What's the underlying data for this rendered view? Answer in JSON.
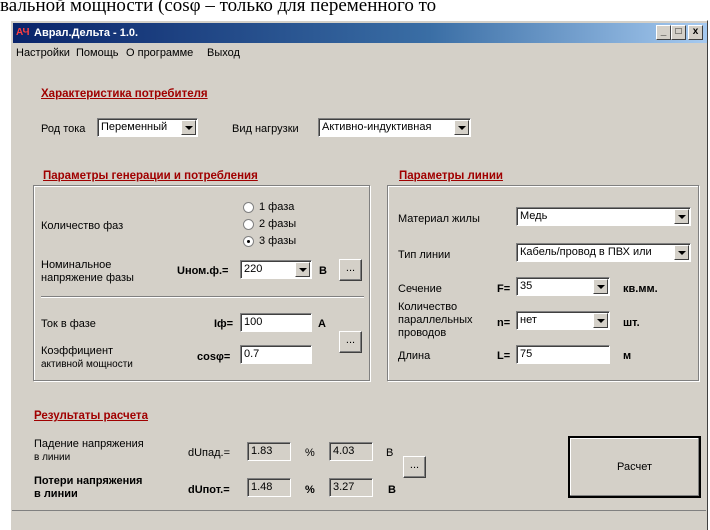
{
  "top_clip_text": "вальной мощности (cosφ – только для переменного то",
  "window": {
    "title": "Аврал.Дельта - 1.0.",
    "icon": "АЧ",
    "controls": [
      "_",
      "□",
      "x"
    ]
  },
  "menu": [
    "Настройки",
    "Помощь",
    "О программе",
    "Выход"
  ],
  "consumer": {
    "title": "Характеристика потребителя",
    "current_type_label": "Род тока",
    "current_type_value": "Переменный",
    "load_type_label": "Вид нагрузки",
    "load_type_value": "Активно-индуктивная"
  },
  "generation": {
    "title": "Параметры генерации и потребления",
    "phases_label": "Количество фаз",
    "phase_options": [
      "1 фаза",
      "2 фазы",
      "3 фазы"
    ],
    "phase_selected": 2,
    "voltage_label_1": "Номинальное",
    "voltage_label_2": "напряжение фазы",
    "voltage_symbol": "Uном.ф.=",
    "voltage_value": "220",
    "voltage_unit": "В",
    "current_label": "Ток в фазе",
    "current_symbol": "Iф=",
    "current_value": "100",
    "current_unit": "А",
    "cos_label_1": "Коэффициент",
    "cos_label_2": "активной мощности",
    "cos_symbol": "cosφ=",
    "cos_value": "0.7",
    "ellipsis": "..."
  },
  "line": {
    "title": "Параметры линии",
    "material_label": "Материал жилы",
    "material_value": "Медь",
    "linetype_label": "Тип линии",
    "linetype_value": "Кабель/провод в ПВХ или",
    "section_label": "Сечение",
    "section_symbol": "F=",
    "section_value": "35",
    "section_unit": "кв.мм.",
    "parallel_label_1": "Количество",
    "parallel_label_2": "параллельных",
    "parallel_label_3": "проводов",
    "parallel_symbol": "n=",
    "parallel_value": "нет",
    "parallel_unit": "шт.",
    "length_label": "Длина",
    "length_symbol": "L=",
    "length_value": "75",
    "length_unit": "м"
  },
  "results": {
    "title": "Результаты расчета",
    "drop_label_1": "Падение напряжения",
    "drop_label_2": "в линии",
    "drop_symbol": "dUпад.=",
    "drop_percent": "1.83",
    "drop_volts": "4.03",
    "loss_label_1": "Потери напряжения",
    "loss_label_2": "в линии",
    "loss_symbol": "dUпот.=",
    "loss_percent": "1.48",
    "loss_volts": "3.27",
    "percent_unit": "%",
    "volt_unit": "В",
    "calculate_label": "Расчет",
    "ellipsis": "..."
  }
}
